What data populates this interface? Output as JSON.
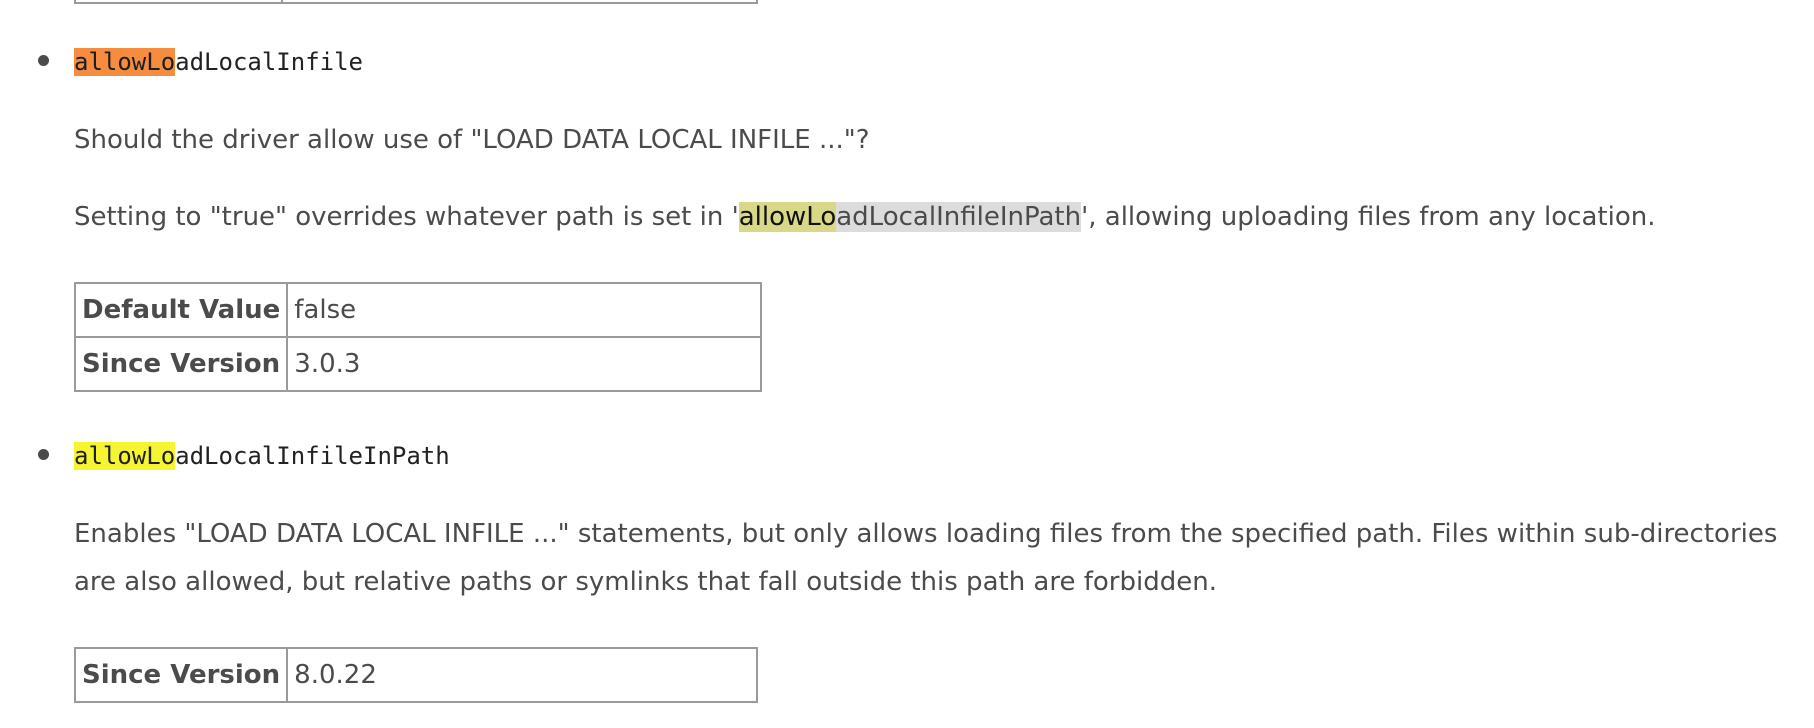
{
  "sections": [
    {
      "name_highlight": "allowLo",
      "name_rest": "adLocalInfile",
      "description": "Should the driver allow use of \"LOAD DATA LOCAL INFILE ...\"?",
      "note_pre": "Setting to \"true\" overrides whatever path is set in '",
      "note_link_highlight": "allowLo",
      "note_link_rest": "adLocalInfileInPath",
      "note_post": "', allowing uploading files from any location.",
      "table": [
        {
          "key": "Default Value",
          "value": "false"
        },
        {
          "key": "Since Version",
          "value": "3.0.3"
        }
      ]
    },
    {
      "name_highlight": "allowLo",
      "name_rest": "adLocalInfileInPath",
      "description": "Enables \"LOAD DATA LOCAL INFILE ...\" statements, but only allows loading files from the specified path. Files within sub-directories are also allowed, but relative paths or symlinks that fall outside this path are forbidden.",
      "table": [
        {
          "key": "Since Version",
          "value": "8.0.22"
        }
      ]
    }
  ],
  "colors": {
    "current_match": "#f58c3f",
    "other_match": "#f5f532",
    "selected_match": "#d8d886",
    "selection": "#dcdcdc",
    "text": "#4b4b4b",
    "table_border": "#9a9a9a"
  }
}
